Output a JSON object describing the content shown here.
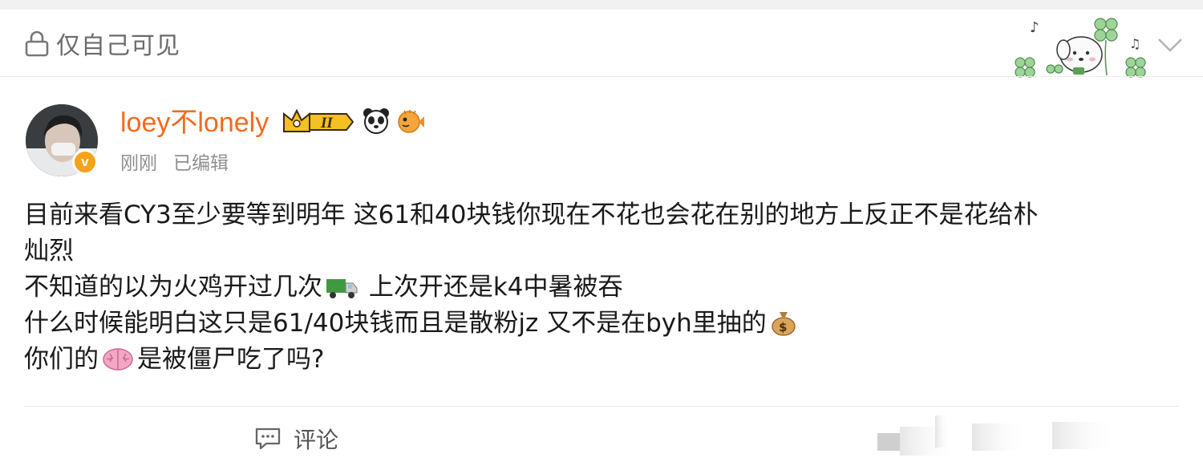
{
  "privacy": {
    "label": "仅自己可见",
    "icon": "lock-icon"
  },
  "post": {
    "username": "loey不lonely",
    "level_badge": "II",
    "verified_mark": "v",
    "time": "刚刚",
    "edited": "已编辑",
    "lines": [
      "目前来看CY3至少要等到明年 这61和40块钱你现在不花也会花在别的地方上反正不是花给朴",
      "灿烈",
      "不知道的以为火鸡开过几次",
      "上次开还是k4中暑被吞",
      "什么时候能明白这只是61/40块钱而且是散粉jz 又不是在byh里抽的",
      "你们的",
      "是被僵尸吃了吗?"
    ]
  },
  "actions": {
    "comment_label": "评论"
  },
  "colors": {
    "username": "#f26b1d",
    "meta": "#8f8f8f",
    "privacy": "#6b6b6b",
    "badge": "#f7a21b"
  }
}
